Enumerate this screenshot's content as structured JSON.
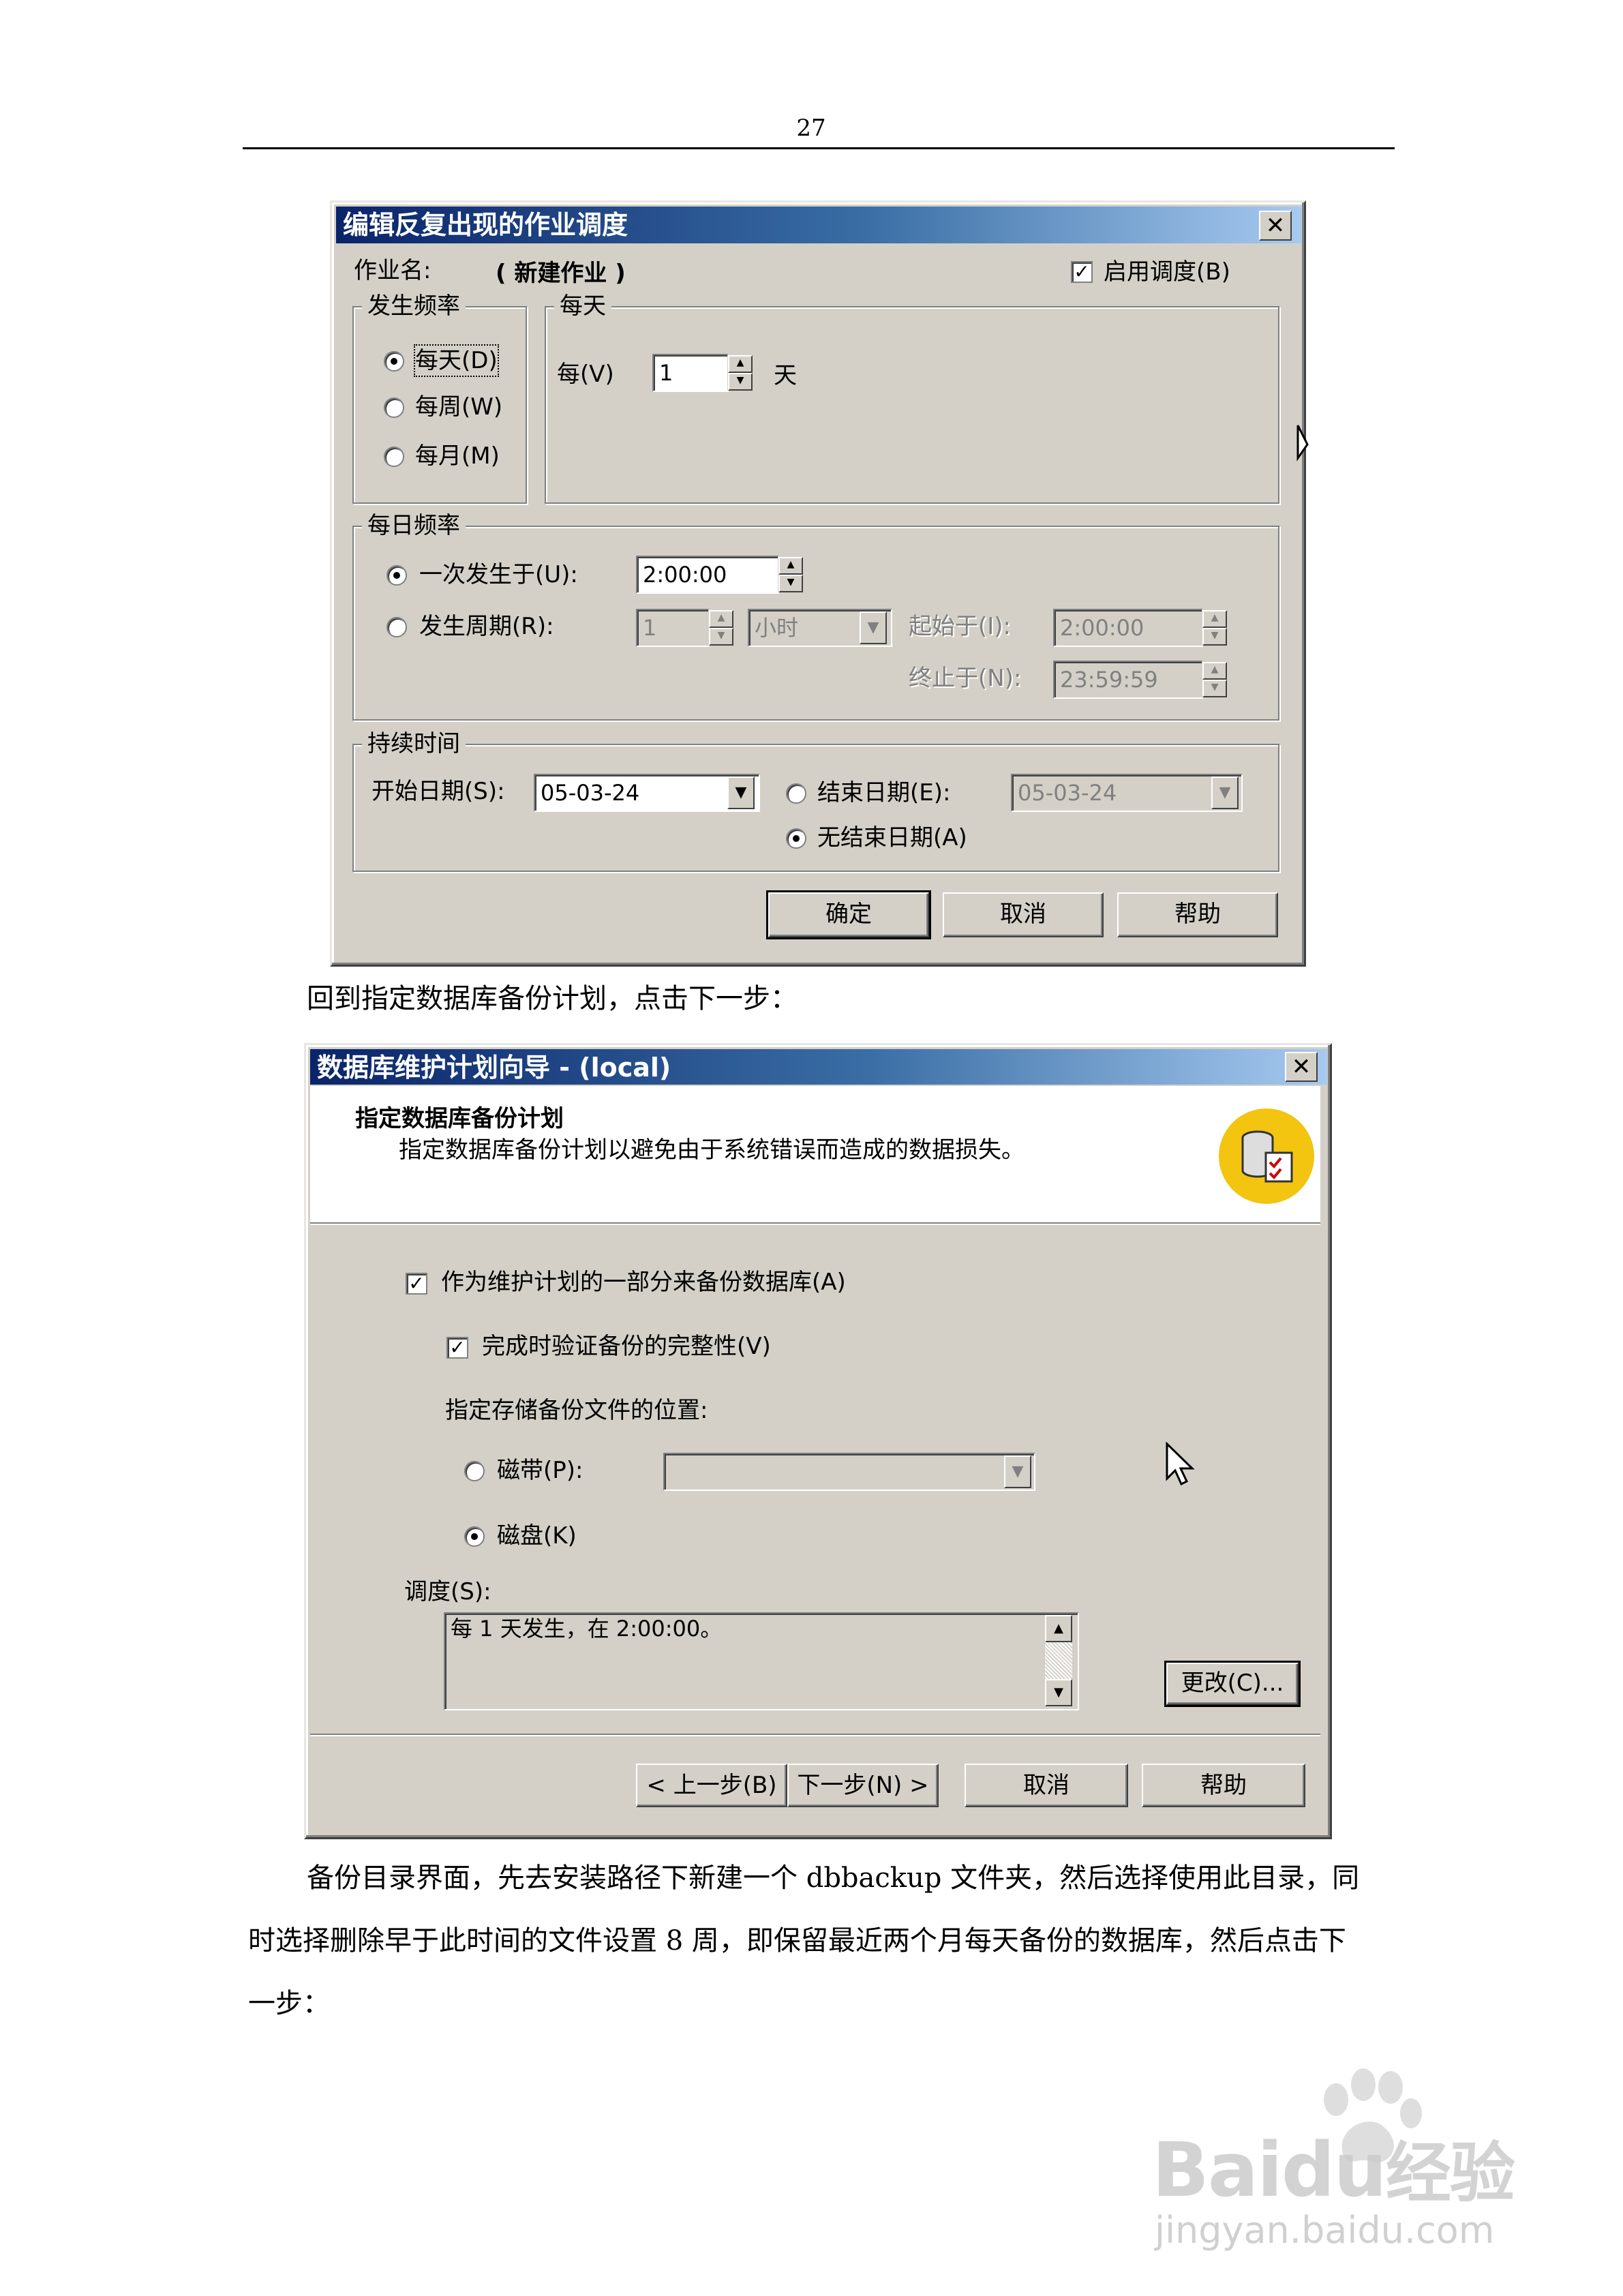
{
  "page": {
    "number": "27"
  },
  "dialog1": {
    "title": "编辑反复出现的作业调度",
    "close": "✕",
    "job_name_label": "作业名:",
    "job_name_value": "( 新建作业 )",
    "enable_schedule": "启用调度(B)",
    "freq_group": "发生频率",
    "freq_daily": "每天(D)",
    "freq_weekly": "每周(W)",
    "freq_monthly": "每月(M)",
    "daily_group": "每天",
    "every_label": "每(V)",
    "every_value": "1",
    "day_unit": "天",
    "daily_freq_group": "每日频率",
    "once_at": "一次发生于(U):",
    "once_time": "2:00:00",
    "recur": "发生周期(R):",
    "recur_value": "1",
    "recur_unit": "小时",
    "start_at_label": "起始于(I):",
    "start_at_value": "2:00:00",
    "end_at_label": "终止于(N):",
    "end_at_value": "23:59:59",
    "duration_group": "持续时间",
    "start_date_label": "开始日期(S):",
    "start_date_value": "05-03-24",
    "end_date_label": "结束日期(E):",
    "end_date_value": "05-03-24",
    "no_end_date": "无结束日期(A)",
    "ok": "确定",
    "cancel": "取消",
    "help": "帮助"
  },
  "caption1": "回到指定数据库备份计划，点击下一步：",
  "dialog2": {
    "title": "数据库维护计划向导 - (local)",
    "close": "✕",
    "heading": "指定数据库备份计划",
    "subheading": "指定数据库备份计划以避免由于系统错误而造成的数据损失。",
    "backup_check": "作为维护计划的一部分来备份数据库(A)",
    "verify_check": "完成时验证备份的完整性(V)",
    "location_label": "指定存储备份文件的位置:",
    "tape": "磁带(P):",
    "disk": "磁盘(K)",
    "schedule_label": "调度(S):",
    "schedule_text": "每 1 天发生，在 2:00:00。",
    "change": "更改(C)...",
    "back": "< 上一步(B)",
    "next": "下一步(N) >",
    "cancel": "取消",
    "help": "帮助"
  },
  "paragraph": {
    "line1": "备份目录界面，先去安装路径下新建一个 dbbackup 文件夹，然后选择使用此目录，同",
    "line2": "时选择删除早于此时间的文件设置 8 周，即保留最近两个月每天备份的数据库，然后点击下",
    "line3": "一步："
  },
  "watermark": {
    "brand": "Bai",
    "brand2": "du",
    "brand3": "经验",
    "url": "jingyan.baidu.com"
  }
}
